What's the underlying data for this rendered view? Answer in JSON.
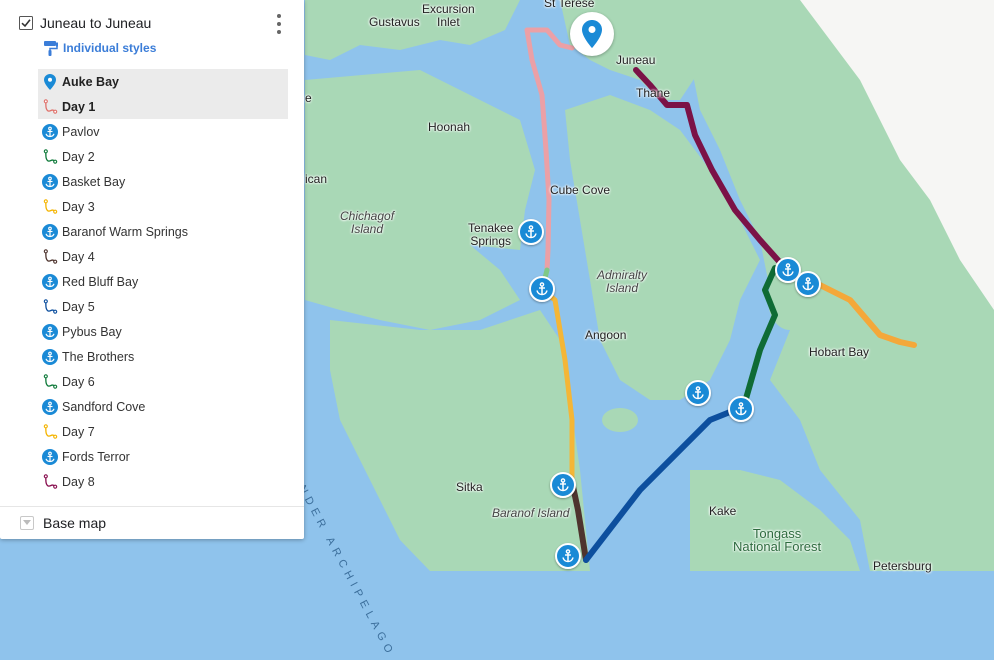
{
  "panel": {
    "layer_title": "Juneau to Juneau",
    "styles_label": "Individual styles",
    "items": [
      {
        "label": "Auke Bay",
        "icon": "location-pin-icon",
        "color": "#1a8ad6",
        "selected": true
      },
      {
        "label": "Day 1",
        "icon": "route-icon",
        "color": "#e0726c",
        "selected": true
      },
      {
        "label": "Pavlov",
        "icon": "anchor-icon",
        "color": "#1a8ad6",
        "selected": false
      },
      {
        "label": "Day 2",
        "icon": "route-icon",
        "color": "#0f7a3a",
        "selected": false
      },
      {
        "label": "Basket Bay",
        "icon": "anchor-icon",
        "color": "#1a8ad6",
        "selected": false
      },
      {
        "label": "Day 3",
        "icon": "route-icon",
        "color": "#f4b400",
        "selected": false
      },
      {
        "label": "Baranof Warm Springs",
        "icon": "anchor-icon",
        "color": "#1a8ad6",
        "selected": false
      },
      {
        "label": "Day 4",
        "icon": "route-icon",
        "color": "#4e342e",
        "selected": false
      },
      {
        "label": "Red Bluff Bay",
        "icon": "anchor-icon",
        "color": "#1a8ad6",
        "selected": false
      },
      {
        "label": "Day 5",
        "icon": "route-icon",
        "color": "#0d4f9e",
        "selected": false
      },
      {
        "label": "Pybus Bay",
        "icon": "anchor-icon",
        "color": "#1a8ad6",
        "selected": false
      },
      {
        "label": "The Brothers",
        "icon": "anchor-icon",
        "color": "#1a8ad6",
        "selected": false
      },
      {
        "label": "Day 6",
        "icon": "route-icon",
        "color": "#0f7a3a",
        "selected": false
      },
      {
        "label": "Sandford Cove",
        "icon": "anchor-icon",
        "color": "#1a8ad6",
        "selected": false
      },
      {
        "label": "Day 7",
        "icon": "route-icon",
        "color": "#f4b400",
        "selected": false
      },
      {
        "label": "Fords Terror",
        "icon": "anchor-icon",
        "color": "#1a8ad6",
        "selected": false
      },
      {
        "label": "Day 8",
        "icon": "route-icon",
        "color": "#880e4f",
        "selected": false
      }
    ],
    "base_map_label": "Base map"
  },
  "map_labels": {
    "gustavus": "Gustavus",
    "excursion_inlet": "Excursion\nInlet",
    "st_terese": "St Terese",
    "juneau": "Juneau",
    "thane": "Thane",
    "hoonah": "Hoonah",
    "cube_cove": "Cube Cove",
    "chichagof_island": "Chichagof\nIsland",
    "tenakee_springs": "Tenakee\nSprings",
    "admiralty_island": "Admiralty\nIsland",
    "angoon": "Angoon",
    "hobart_bay": "Hobart Bay",
    "sitka": "Sitka",
    "baranof_island": "Baranof Island",
    "kake": "Kake",
    "tongass_national_forest": "Tongass\nNational Forest",
    "petersburg": "Petersburg",
    "alexander_archipelago": "ALEXANDER ARCHIPELAGO",
    "edge_icean": "ican",
    "edge_e": "e"
  },
  "colors": {
    "water": "#8fc3ec",
    "land": "#a9d8b6",
    "day1": "#eba0a6",
    "day2": "#7fc987",
    "day3": "#f4b637",
    "day4": "#4e342e",
    "day5": "#0d4f9e",
    "day6": "#0f6b35",
    "day7": "#f4a83a",
    "day8": "#7b1247",
    "anchor": "#1a8ad6"
  }
}
